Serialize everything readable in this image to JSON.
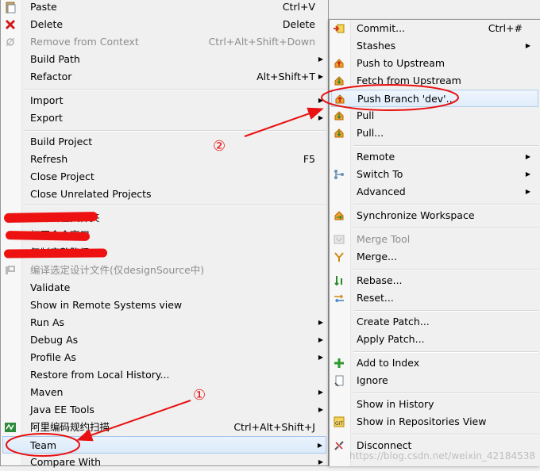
{
  "main_menu": {
    "items": [
      {
        "label": "Paste",
        "accel": "Ctrl+V",
        "icon": "paste-icon"
      },
      {
        "label": "Delete",
        "accel": "Delete",
        "icon": "delete-icon"
      },
      {
        "label": "Remove from Context",
        "accel": "Ctrl+Alt+Shift+Down",
        "icon": "remove-context-icon",
        "disabled": true
      },
      {
        "label": "Build Path",
        "submenu": true
      },
      {
        "label": "Refactor",
        "accel": "Alt+Shift+T",
        "submenu": true
      },
      {
        "label": "Import",
        "submenu": true
      },
      {
        "label": "Export",
        "submenu": true
      },
      {
        "label": "Build Project"
      },
      {
        "label": "Refresh",
        "accel": "F5"
      },
      {
        "label": "Close Project"
      },
      {
        "label": "Close Unrelated Projects"
      },
      {
        "label": "打开所在文件夹",
        "redacted": true
      },
      {
        "label": "打开命令窗口",
        "redacted": true
      },
      {
        "label": "复制完整路径",
        "redacted": true
      },
      {
        "label": "编译选定设计文件(仅designSource中)",
        "icon": "compile-design-icon",
        "disabled": true
      },
      {
        "label": "Validate"
      },
      {
        "label": "Show in Remote Systems view"
      },
      {
        "label": "Run As",
        "submenu": true
      },
      {
        "label": "Debug As",
        "submenu": true
      },
      {
        "label": "Profile As",
        "submenu": true
      },
      {
        "label": "Restore from Local History..."
      },
      {
        "label": "Maven",
        "submenu": true
      },
      {
        "label": "Java EE Tools",
        "submenu": true
      },
      {
        "label": "阿里编码规约扫描",
        "accel": "Ctrl+Alt+Shift+J",
        "icon": "code-scan-icon"
      },
      {
        "label": "Team",
        "submenu": true,
        "highlighted": true
      },
      {
        "label": "Compare With",
        "submenu": true
      }
    ]
  },
  "team_menu": {
    "items": [
      {
        "label": "Commit...",
        "accel": "Ctrl+#",
        "icon": "commit-icon"
      },
      {
        "label": "Stashes",
        "submenu": true
      },
      {
        "label": "Push to Upstream",
        "icon": "push-upstream-icon"
      },
      {
        "label": "Fetch from Upstream",
        "icon": "fetch-upstream-icon"
      },
      {
        "label": "Push Branch 'dev'...",
        "icon": "push-branch-icon",
        "highlighted": true
      },
      {
        "label": "Pull",
        "icon": "pull-icon"
      },
      {
        "label": "Pull...",
        "icon": "pull-dialog-icon"
      },
      {
        "label": "Remote",
        "submenu": true
      },
      {
        "label": "Switch To",
        "submenu": true,
        "icon": "switch-branch-icon"
      },
      {
        "label": "Advanced",
        "submenu": true
      },
      {
        "label": "Synchronize Workspace",
        "icon": "synchronize-icon"
      },
      {
        "label": "Merge Tool",
        "icon": "merge-tool-icon",
        "disabled": true
      },
      {
        "label": "Merge...",
        "icon": "merge-icon"
      },
      {
        "label": "Rebase...",
        "icon": "rebase-icon"
      },
      {
        "label": "Reset...",
        "icon": "reset-icon"
      },
      {
        "label": "Create Patch..."
      },
      {
        "label": "Apply Patch..."
      },
      {
        "label": "Add to Index",
        "icon": "add-index-icon"
      },
      {
        "label": "Ignore",
        "icon": "ignore-icon"
      },
      {
        "label": "Show in History"
      },
      {
        "label": "Show in Repositories View",
        "icon": "git-repo-icon"
      },
      {
        "label": "Disconnect",
        "icon": "disconnect-icon"
      }
    ]
  },
  "annotations": {
    "step1": "①",
    "step2": "②",
    "color": "#e81010"
  },
  "watermark": "https://blog.csdn.net/weixin_42184538"
}
